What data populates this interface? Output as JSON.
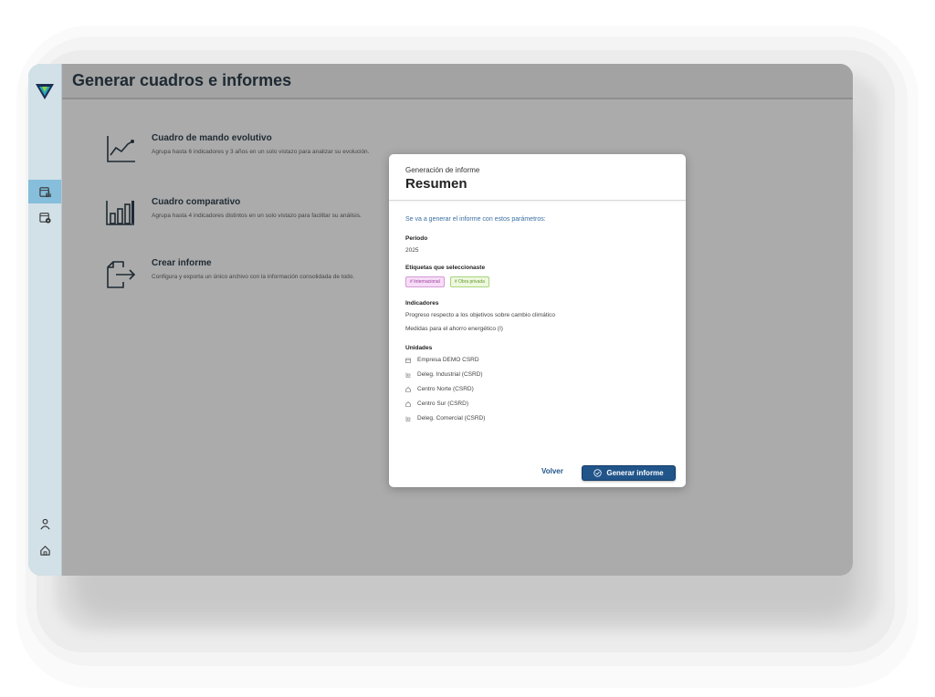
{
  "header": {
    "title": "Generar cuadros e informes"
  },
  "options": [
    {
      "title": "Cuadro de mando evolutivo",
      "description": "Agrupa hasta 6 indicadores y 3 años en un solo vistazo para analizar su evolución."
    },
    {
      "title": "Cuadro comparativo",
      "description": "Agrupa hasta 4 indicadores distintos en un solo vistazo para facilitar su análisis."
    },
    {
      "title": "Crear informe",
      "description": "Configura y exporta un único archivo con la información consolidada de todo."
    }
  ],
  "modal": {
    "subtitle": "Generación de informe",
    "title": "Resumen",
    "intro": "Se va a generar el informe con estos parámetros:",
    "period_label": "Periodo",
    "period_value": "2025",
    "tags_label": "Etiquetas que seleccionaste",
    "tags": [
      "# Internacional",
      "# Obra privada"
    ],
    "indicators_label": "Indicadores",
    "indicators": [
      "Progreso respecto a los objetivos sobre cambio climático",
      "Medidas para el ahorro energético (I)"
    ],
    "units_label": "Unidades",
    "units": [
      {
        "name": "Empresa DEMO CSRD",
        "icon": "building-icon"
      },
      {
        "name": "Deleg. Industrial (CSRD)",
        "icon": "branch-icon"
      },
      {
        "name": "Centro Norte (CSRD)",
        "icon": "home-icon"
      },
      {
        "name": "Centro Sur (CSRD)",
        "icon": "home-icon"
      },
      {
        "name": "Deleg. Comercial (CSRD)",
        "icon": "branch-icon"
      }
    ],
    "back_label": "Volver",
    "generate_label": "Generar informe"
  },
  "colors": {
    "accent": "#21558a",
    "sidebar": "#d2e0e7",
    "sidebar_active": "#86bedb",
    "overlay": "#ababab"
  }
}
